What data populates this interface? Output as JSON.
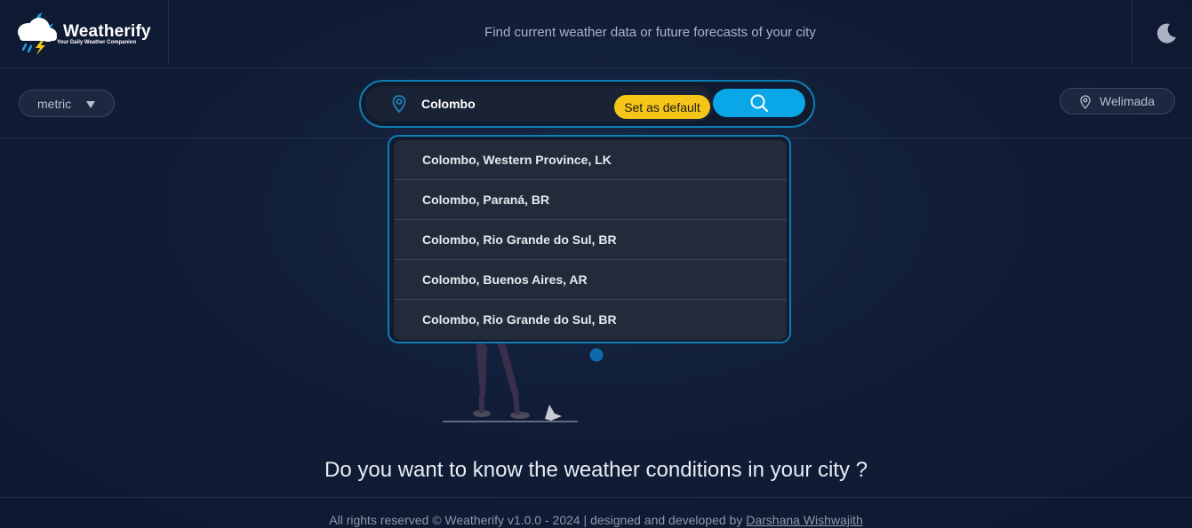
{
  "brand": {
    "name": "Weatherify",
    "tagline": "Your Daily Weather Companion"
  },
  "header": {
    "subtitle": "Find current weather data or future forecasts of your city"
  },
  "units": {
    "selected": "metric"
  },
  "search": {
    "value": "Colombo",
    "set_default_label": "Set as default"
  },
  "current_location": {
    "label": "Welimada"
  },
  "suggestions": [
    "Colombo, Western Province, LK",
    "Colombo, Paraná, BR",
    "Colombo, Rio Grande do Sul, BR",
    "Colombo, Buenos Aires, AR",
    "Colombo, Rio Grande do Sul, BR"
  ],
  "main": {
    "question": "Do you want to know the weather conditions in your city ?"
  },
  "footer": {
    "text": "All rights reserved © Weatherify v1.0.0 - 2024 | designed and developed by",
    "author": "Darshana Wishwajith"
  },
  "colors": {
    "accent": "#0aa7e8",
    "default_button": "#f5c518",
    "border_accent": "#0d7fb3"
  }
}
